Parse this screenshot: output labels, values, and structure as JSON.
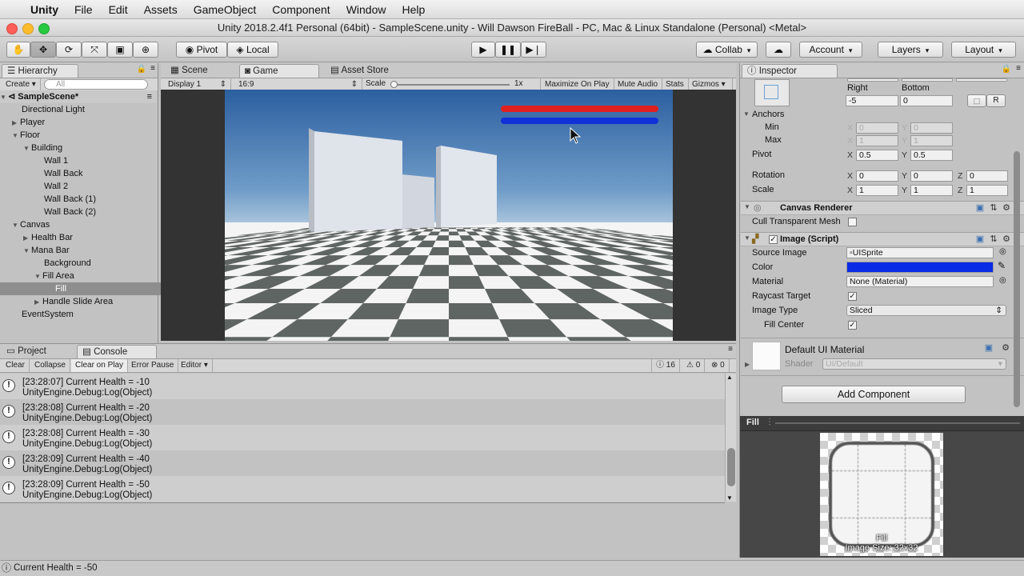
{
  "menubar": {
    "app": "Unity",
    "items": [
      "File",
      "Edit",
      "Assets",
      "GameObject",
      "Component",
      "Window",
      "Help"
    ]
  },
  "window": {
    "title": "Unity 2018.2.4f1 Personal (64bit) - SampleScene.unity - Will Dawson FireBall - PC, Mac & Linux Standalone (Personal) <Metal>"
  },
  "toolbar": {
    "pivot": "Pivot",
    "local": "Local",
    "collab": "Collab",
    "account": "Account",
    "layers": "Layers",
    "layout": "Layout"
  },
  "hierarchy": {
    "tab": "Hierarchy",
    "create": "Create",
    "search_placeholder": "All",
    "scene": "SampleScene*",
    "items": [
      {
        "label": "Directional Light"
      },
      {
        "label": "Player"
      },
      {
        "label": "Floor"
      },
      {
        "label": "Building"
      },
      {
        "label": "Wall 1"
      },
      {
        "label": "Wall Back"
      },
      {
        "label": "Wall 2"
      },
      {
        "label": "Wall Back (1)"
      },
      {
        "label": "Wall Back (2)"
      },
      {
        "label": "Canvas"
      },
      {
        "label": "Health Bar"
      },
      {
        "label": "Mana Bar"
      },
      {
        "label": "Background"
      },
      {
        "label": "Fill Area"
      },
      {
        "label": "Fill"
      },
      {
        "label": "Handle Slide Area"
      },
      {
        "label": "EventSystem"
      }
    ]
  },
  "game": {
    "tabs": [
      "Scene",
      "Game",
      "Asset Store"
    ],
    "display": "Display 1",
    "aspect": "16:9",
    "scale_label": "Scale",
    "scale_value": "1x",
    "options": [
      "Maximize On Play",
      "Mute Audio",
      "Stats",
      "Gizmos"
    ],
    "health_color": "#e0201e",
    "mana_color": "#1030d8"
  },
  "console": {
    "tabs": [
      "Project",
      "Console"
    ],
    "buttons": [
      "Clear",
      "Collapse",
      "Clear on Play",
      "Error Pause",
      "Editor"
    ],
    "counts": {
      "info": "16",
      "warn": "0",
      "error": "0"
    },
    "logs": [
      {
        "line1": "[23:28:07] Current Health = -10",
        "line2": "UnityEngine.Debug:Log(Object)"
      },
      {
        "line1": "[23:28:08] Current Health = -20",
        "line2": "UnityEngine.Debug:Log(Object)"
      },
      {
        "line1": "[23:28:08] Current Health = -30",
        "line2": "UnityEngine.Debug:Log(Object)"
      },
      {
        "line1": "[23:28:09] Current Health = -40",
        "line2": "UnityEngine.Debug:Log(Object)"
      },
      {
        "line1": "[23:28:09] Current Health = -50",
        "line2": "UnityEngine.Debug:Log(Object)"
      }
    ]
  },
  "inspector": {
    "tab": "Inspector",
    "right_label": "Right",
    "bottom_label": "Bottom",
    "right_value": "-5",
    "bottom_value": "0",
    "r_button": "R",
    "anchors": "Anchors",
    "min": "Min",
    "max": "Max",
    "min_x": "0",
    "min_y": "0",
    "max_x": "1",
    "max_y": "1",
    "pivot": "Pivot",
    "pivot_x": "0.5",
    "pivot_y": "0.5",
    "rotation": "Rotation",
    "rot_x": "0",
    "rot_y": "0",
    "rot_z": "0",
    "scale": "Scale",
    "scale_x": "1",
    "scale_y": "1",
    "scale_z": "1",
    "canvas_renderer": "Canvas Renderer",
    "cull": "Cull Transparent Mesh",
    "image_script": "Image (Script)",
    "source_image": "Source Image",
    "source_value": "UISprite",
    "color": "Color",
    "color_value": "#0a2be6",
    "material": "Material",
    "material_value": "None (Material)",
    "raycast": "Raycast Target",
    "image_type": "Image Type",
    "image_type_value": "Sliced",
    "fill_center": "Fill Center",
    "default_material": "Default UI Material",
    "shader": "Shader",
    "shader_value": "UI/Default",
    "add_component": "Add Component",
    "axis_x": "X",
    "axis_y": "Y",
    "axis_z": "Z"
  },
  "preview": {
    "title": "Fill",
    "name": "Fill",
    "size": "Image Size: 32x32"
  },
  "status": {
    "message": "Current Health = -50"
  }
}
